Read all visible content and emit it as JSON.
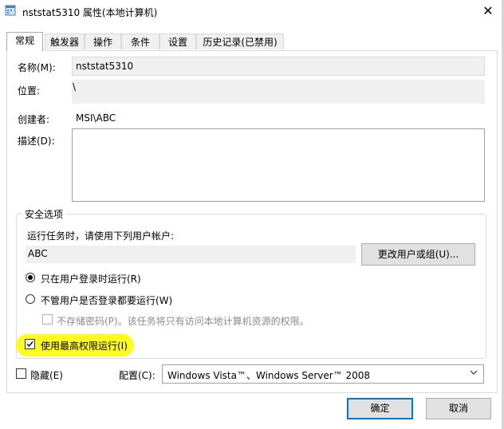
{
  "window": {
    "title": "nststat5310 属性(本地计算机)",
    "close_glyph": "✕"
  },
  "tabs": [
    {
      "label": "常规",
      "active": true
    },
    {
      "label": "触发器"
    },
    {
      "label": "操作"
    },
    {
      "label": "条件"
    },
    {
      "label": "设置"
    },
    {
      "label": "历史记录(已禁用)"
    }
  ],
  "general": {
    "name_label": "名称(M):",
    "name_value": "nststat5310",
    "location_label": "位置:",
    "location_value": "\\",
    "author_label": "创建者:",
    "author_value": "MSI\\ABC",
    "description_label": "描述(D):",
    "description_value": ""
  },
  "security": {
    "group_title": "安全选项",
    "run_as_label": "运行任务时，请使用下列用户帐户:",
    "user_account": "ABC",
    "change_user_button": "更改用户或组(U)...",
    "radio_logged_on": "只在用户登录时运行(R)",
    "radio_whether_logged_on": "不管用户是否登录都要运行(W)",
    "no_store_password": "不存储密码(P)。该任务将只有访问本地计算机资源的权限。",
    "highest_privileges": "使用最高权限运行(I)",
    "highest_privileges_checked": true,
    "selected_radio": "logged_on"
  },
  "bottom": {
    "hidden_label": "隐藏(E)",
    "configure_label": "配置(C):",
    "configure_value": "Windows Vista™、Windows Server™ 2008",
    "ok_button": "确定",
    "cancel_button": "取消"
  },
  "colors": {
    "highlight": "#fffb1f",
    "primary_button_border": "#0078d7"
  },
  "icons": {
    "window_icon": "task-scheduler-icon",
    "close": "close-icon",
    "dropdown": "chevron-down-icon",
    "check": "checkmark"
  }
}
